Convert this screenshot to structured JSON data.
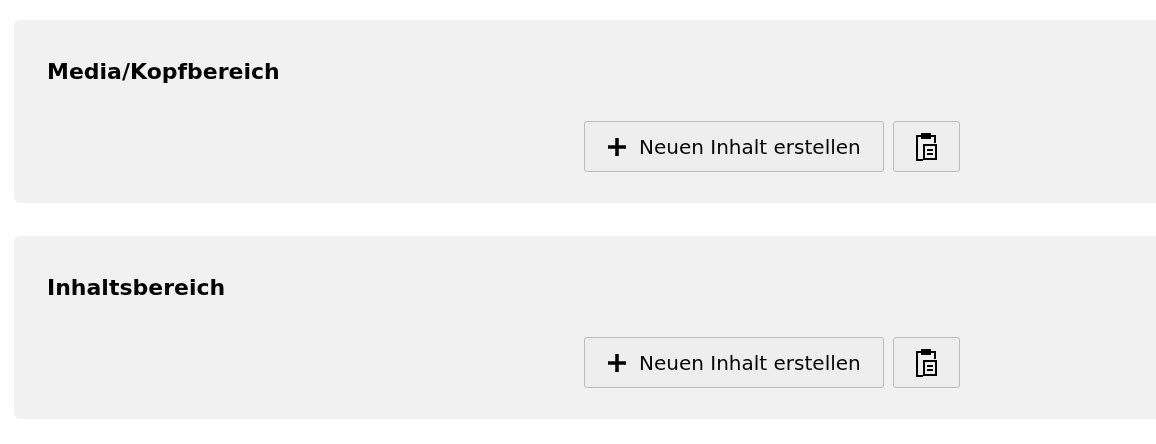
{
  "sections": [
    {
      "title": "Media/Kopfbereich",
      "new_content_button": "Neuen Inhalt erstellen"
    },
    {
      "title": "Inhaltsbereich",
      "new_content_button": "Neuen Inhalt erstellen"
    }
  ]
}
